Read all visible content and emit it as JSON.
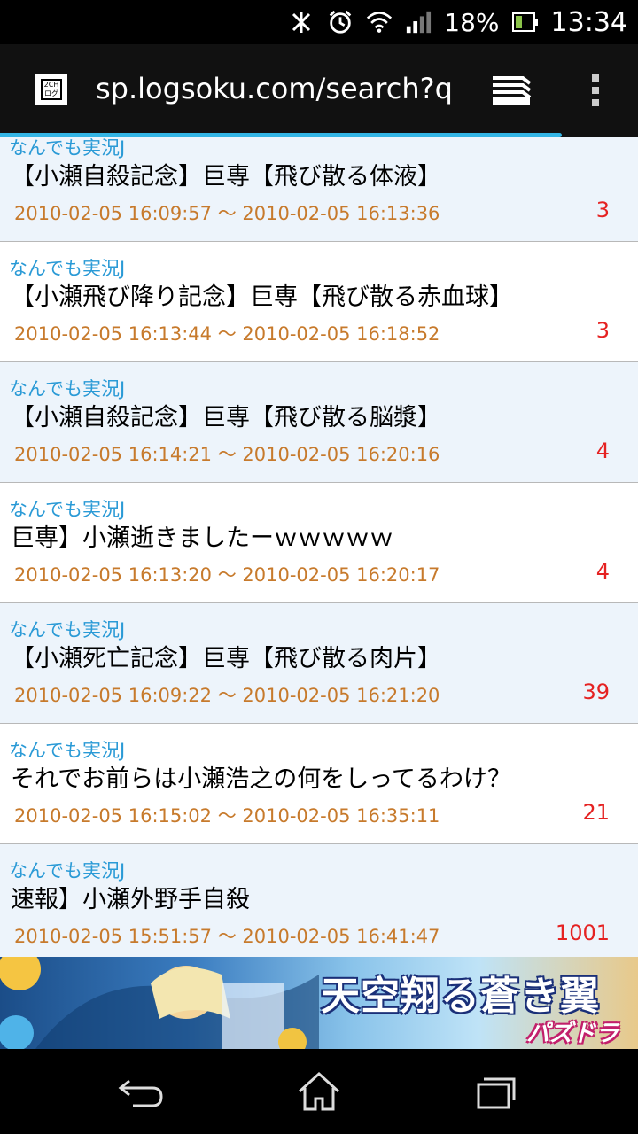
{
  "status_bar": {
    "battery_percent": "18%",
    "time": "13:34",
    "icons": [
      "nfc-off-icon",
      "alarm-icon",
      "wifi-icon",
      "signal-icon",
      "battery-icon"
    ]
  },
  "browser": {
    "url": "sp.logsoku.com/search?q=",
    "qr_text": "2CH\nログ",
    "load_progress": 0.88
  },
  "results": [
    {
      "board": "なんでも実況J",
      "title": "【小瀬自殺記念】巨専【飛び散る体液】",
      "dates": "2010-02-05 16:09:57 〜 2010-02-05 16:13:36",
      "count": "3"
    },
    {
      "board": "なんでも実況J",
      "title": "【小瀬飛び降り記念】巨専【飛び散る赤血球】",
      "dates": "2010-02-05 16:13:44 〜 2010-02-05 16:18:52",
      "count": "3"
    },
    {
      "board": "なんでも実況J",
      "title": "【小瀬自殺記念】巨専【飛び散る脳漿】",
      "dates": "2010-02-05 16:14:21 〜 2010-02-05 16:20:16",
      "count": "4"
    },
    {
      "board": "なんでも実況J",
      "title": "巨専】小瀬逝きましたーｗｗｗｗｗ",
      "dates": "2010-02-05 16:13:20 〜 2010-02-05 16:20:17",
      "count": "4"
    },
    {
      "board": "なんでも実況J",
      "title": "【小瀬死亡記念】巨専【飛び散る肉片】",
      "dates": "2010-02-05 16:09:22 〜 2010-02-05 16:21:20",
      "count": "39"
    },
    {
      "board": "なんでも実況J",
      "title": "それでお前らは小瀬浩之の何をしってるわけ？",
      "dates": "2010-02-05 16:15:02 〜 2010-02-05 16:35:11",
      "count": "21"
    },
    {
      "board": "なんでも実況J",
      "title": "速報】小瀬外野手自殺",
      "dates": "2010-02-05 15:51:57 〜 2010-02-05 16:41:47",
      "count": "1001"
    }
  ],
  "banner": {
    "headline": "天空翔る蒼き翼",
    "brand": "パズドラ"
  },
  "nav_bar": {
    "icons": [
      "back-icon",
      "home-icon",
      "recent-apps-icon"
    ]
  }
}
